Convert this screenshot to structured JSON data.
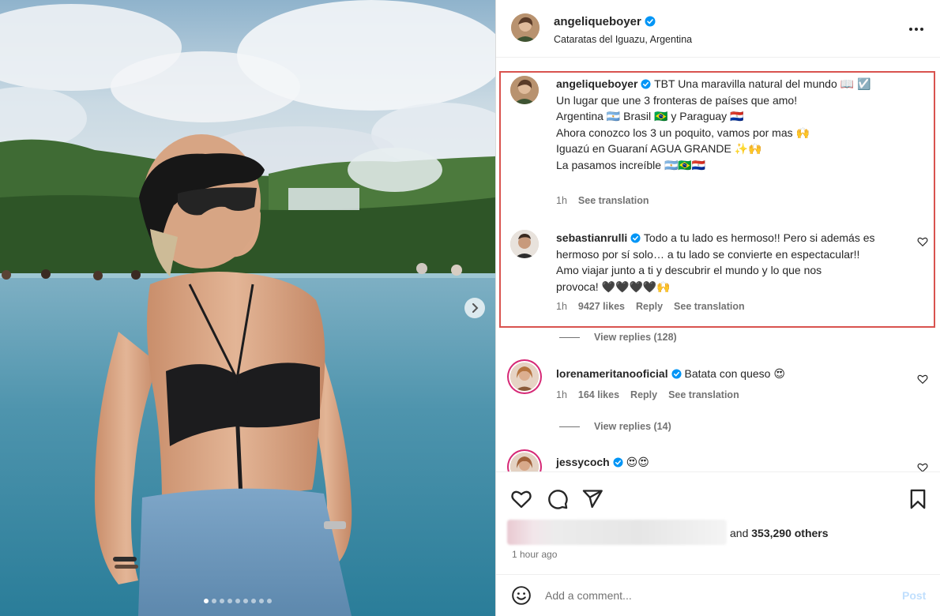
{
  "post": {
    "author": "angeliqueboyer",
    "location": "Cataratas del Iguazu, Argentina",
    "more_icon": "more-horizontal-icon",
    "carousel": {
      "total_slides": 9,
      "active_slide": 1
    }
  },
  "caption": {
    "username": "angeliqueboyer",
    "lines": [
      "TBT Una maravilla natural del mundo 📖 ☑️",
      "Un lugar que une 3 fronteras de países que amo!",
      "Argentina 🇦🇷 Brasil 🇧🇷 y Paraguay 🇵🇾",
      "Ahora conozco los 3 un poquito, vamos por mas 🙌",
      "",
      "Iguazú en Guaraní AGUA GRANDE ✨🙌",
      "La pasamos increíble 🇦🇷🇧🇷🇵🇾"
    ],
    "time": "1h",
    "translate": "See translation"
  },
  "comments": [
    {
      "username": "sebastianrulli",
      "lines": [
        "Todo a tu lado es hermoso!! Pero si además es",
        "hermoso por sí solo… a tu lado se convierte en espectacular!!",
        "Amo viajar junto a ti y descubrir el mundo y lo que nos",
        "provoca! 🖤🖤🖤🖤🙌"
      ],
      "time": "1h",
      "likes": "9427 likes",
      "reply": "Reply",
      "translate": "See translation",
      "view_replies": "View replies (128)"
    },
    {
      "username": "lorenameritanooficial",
      "lines": [
        "Batata con queso 😍"
      ],
      "time": "1h",
      "likes": "164 likes",
      "reply": "Reply",
      "translate": "See translation",
      "view_replies": "View replies (14)"
    },
    {
      "username": "jessycoch",
      "lines": [
        "😍😍"
      ]
    }
  ],
  "actions": {
    "icons": [
      "heart-icon",
      "comment-icon",
      "share-icon",
      "bookmark-icon"
    ],
    "likes_prefix": "and",
    "likes_count": "353,290 others",
    "time_ago": "1 hour ago"
  },
  "composer": {
    "placeholder": "Add a comment...",
    "post_label": "Post"
  },
  "colors": {
    "highlight": "#d9534f",
    "verified": "#0095f6",
    "muted": "#737373",
    "post_disabled": "#c0dffd"
  }
}
